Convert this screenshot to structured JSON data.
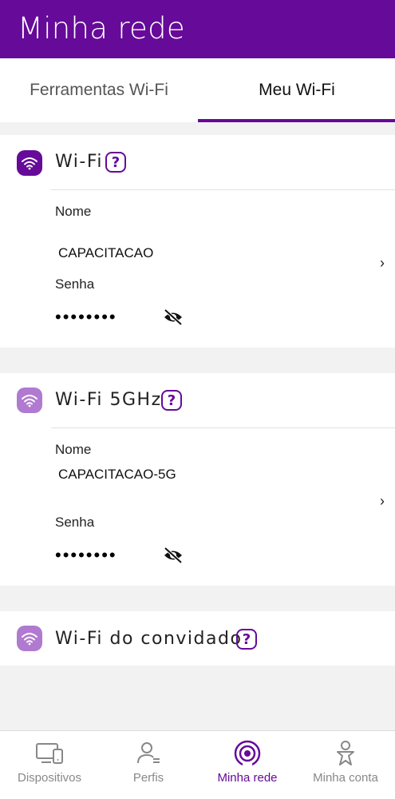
{
  "header": {
    "title": "Minha rede"
  },
  "tabs": [
    {
      "label": "Ferramentas Wi-Fi",
      "active": false
    },
    {
      "label": "Meu Wi-Fi",
      "active": true
    }
  ],
  "networks": [
    {
      "title": "Wi-Fi",
      "name_label": "Nome",
      "name_value": "CAPACITACAO",
      "password_label": "Senha",
      "password_mask": "••••••••",
      "icon": "wifi-icon"
    },
    {
      "title": "Wi-Fi 5GHz",
      "name_label": "Nome",
      "name_value": "CAPACITACAO-5G",
      "password_label": "Senha",
      "password_mask": "••••••••",
      "icon": "wifi-icon"
    }
  ],
  "guest": {
    "title": "Wi-Fi do convidado",
    "icon": "wifi-icon"
  },
  "help_glyph": "?",
  "chevron_glyph": "›",
  "nav": [
    {
      "label": "Dispositivos",
      "icon": "devices-icon",
      "active": false
    },
    {
      "label": "Perfis",
      "icon": "profile-icon",
      "active": false
    },
    {
      "label": "Minha rede",
      "icon": "network-icon",
      "active": true
    },
    {
      "label": "Minha conta",
      "icon": "account-icon",
      "active": false
    }
  ],
  "colors": {
    "brand": "#660a99",
    "brand_light": "#b07ad0",
    "inactive": "#888888"
  }
}
